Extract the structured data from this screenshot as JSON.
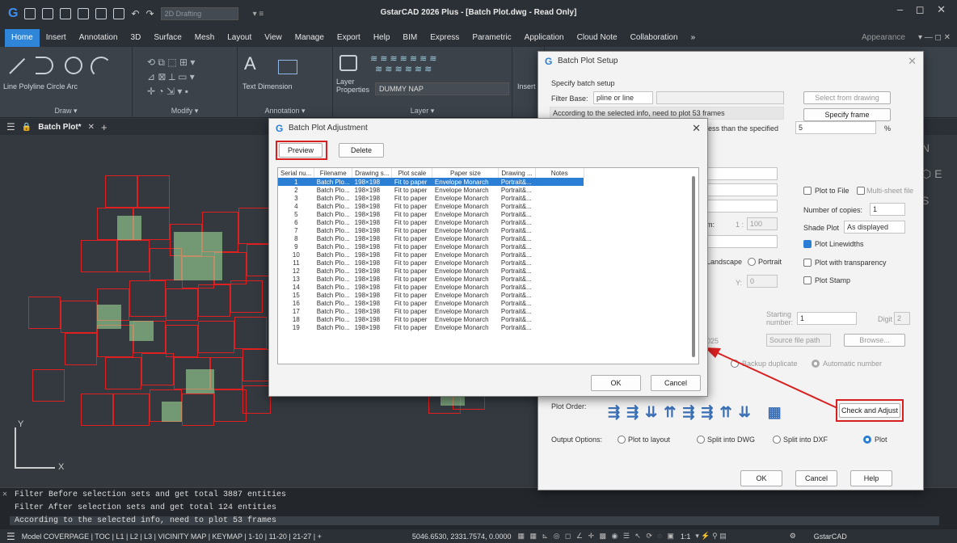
{
  "title": "GstarCAD 2026 Plus - [Batch Plot.dwg - Read Only]",
  "workspace": "2D Drafting",
  "qat_icons": [
    "new-icon",
    "open-icon",
    "save-icon",
    "saveas-icon",
    "publish-icon",
    "print-icon",
    "undo-icon",
    "redo-icon"
  ],
  "menu": [
    "Home",
    "Insert",
    "Annotation",
    "3D",
    "Surface",
    "Mesh",
    "Layout",
    "View",
    "Manage",
    "Export",
    "Help",
    "BIM",
    "Express",
    "Parametric",
    "Application",
    "Cloud Note",
    "Collaboration",
    "»"
  ],
  "appearance": "Appearance",
  "ribbon": {
    "draw": {
      "buttons": "Line  Polyline  Circle    Arc",
      "label": "Draw ▾"
    },
    "modify": {
      "label": "Modify ▾"
    },
    "annotation": {
      "buttons": "Text   Dimension",
      "label": "Annotation ▾"
    },
    "layer": {
      "buttons": "Layer\nProperties",
      "label": "Layer ▾",
      "current": "DUMMY NAP"
    },
    "insert": "Insert"
  },
  "doc_tab": "Batch Plot*",
  "command_lines": [
    "Filter Before selection sets and get total 3887 entities",
    "Filter After selection sets and get total 124 entities",
    "According to the selected info, need to plot 53 frames"
  ],
  "status": {
    "tabs": "Model  COVERPAGE | TOC | L1 | L2 | L3 | VICINITY MAP | KEYMAP | 1-10 | 11-20 | 21-27 |  +",
    "coords": "5046.6530, 2331.7574, 0.0000",
    "scale": "1:1",
    "app": "GstarCAD"
  },
  "setup": {
    "title": "Batch Plot Setup",
    "section": "Specify batch setup",
    "filter_base_label": "Filter Base:",
    "filter_base_value": "pline or line",
    "select_from_drawing": "Select from drawing",
    "info": "According to the selected info, need to plot 53 frames",
    "specify_frame": "Specify frame",
    "less_than": "less than the specified",
    "pct_value": "5",
    "pct": "%",
    "plot_to_file": "Plot to File",
    "multi_sheet": "Multi-sheet file",
    "copies_label": "Number of copies:",
    "copies": "1",
    "shade_label": "Shade Plot",
    "shade_value": "As displayed",
    "scale_m": "m:",
    "scale_1": "1 :",
    "scale_val": "100",
    "plot_linewidths": "Plot Linewidths",
    "landscape": "Landscape",
    "portrait": "Portrait",
    "transparency": "Plot with transparency",
    "y_label": "Y:",
    "y_val": "0",
    "stamp": "Plot Stamp",
    "starting_label": "Starting\nnumber:",
    "starting": "1",
    "digit_label": "Digit",
    "digit": "2",
    "num_025": "025",
    "source": "Source file path",
    "browse": "Browse...",
    "backup": "Backup duplicate",
    "auto_number": "Automatic number",
    "plot_order": "Plot Order:",
    "check_adjust": "Check and Adjust",
    "output_label": "Output Options:",
    "out_layout": "Plot to layout",
    "out_dwg": "Split into DWG",
    "out_dxf": "Split into DXF",
    "out_plot": "Plot",
    "ok": "OK",
    "cancel": "Cancel",
    "help": "Help"
  },
  "adjust": {
    "title": "Batch Plot Adjustment",
    "preview": "Preview",
    "delete": "Delete",
    "columns": [
      "Serial nu...",
      "Filename",
      "Drawing s...",
      "Plot scale",
      "Paper size",
      "Drawing ...",
      "Notes"
    ],
    "rows": [
      [
        "1",
        "Batch Plo...",
        "198×198",
        "Fit to paper",
        "Envelope Monarch",
        "Portrait&..."
      ],
      [
        "2",
        "Batch Plo...",
        "198×198",
        "Fit to paper",
        "Envelope Monarch",
        "Portrait&..."
      ],
      [
        "3",
        "Batch Plo...",
        "198×198",
        "Fit to paper",
        "Envelope Monarch",
        "Portrait&..."
      ],
      [
        "4",
        "Batch Plo...",
        "198×198",
        "Fit to paper",
        "Envelope Monarch",
        "Portrait&..."
      ],
      [
        "5",
        "Batch Plo...",
        "198×198",
        "Fit to paper",
        "Envelope Monarch",
        "Portrait&..."
      ],
      [
        "6",
        "Batch Plo...",
        "198×198",
        "Fit to paper",
        "Envelope Monarch",
        "Portrait&..."
      ],
      [
        "7",
        "Batch Plo...",
        "198×198",
        "Fit to paper",
        "Envelope Monarch",
        "Portrait&..."
      ],
      [
        "8",
        "Batch Plo...",
        "198×198",
        "Fit to paper",
        "Envelope Monarch",
        "Portrait&..."
      ],
      [
        "9",
        "Batch Plo...",
        "198×198",
        "Fit to paper",
        "Envelope Monarch",
        "Portrait&..."
      ],
      [
        "10",
        "Batch Plo...",
        "198×198",
        "Fit to paper",
        "Envelope Monarch",
        "Portrait&..."
      ],
      [
        "11",
        "Batch Plo...",
        "198×198",
        "Fit to paper",
        "Envelope Monarch",
        "Portrait&..."
      ],
      [
        "12",
        "Batch Plo...",
        "198×198",
        "Fit to paper",
        "Envelope Monarch",
        "Portrait&..."
      ],
      [
        "13",
        "Batch Plo...",
        "198×198",
        "Fit to paper",
        "Envelope Monarch",
        "Portrait&..."
      ],
      [
        "14",
        "Batch Plo...",
        "198×198",
        "Fit to paper",
        "Envelope Monarch",
        "Portrait&..."
      ],
      [
        "15",
        "Batch Plo...",
        "198×198",
        "Fit to paper",
        "Envelope Monarch",
        "Portrait&..."
      ],
      [
        "16",
        "Batch Plo...",
        "198×198",
        "Fit to paper",
        "Envelope Monarch",
        "Portrait&..."
      ],
      [
        "17",
        "Batch Plo...",
        "198×198",
        "Fit to paper",
        "Envelope Monarch",
        "Portrait&..."
      ],
      [
        "18",
        "Batch Plo...",
        "198×198",
        "Fit to paper",
        "Envelope Monarch",
        "Portrait&..."
      ],
      [
        "19",
        "Batch Plo...",
        "198×198",
        "Fit to paper",
        "Envelope Monarch",
        "Portrait&..."
      ]
    ],
    "ok": "OK",
    "cancel": "Cancel"
  },
  "colors": {
    "accent": "#2f86d8",
    "frame_red": "#e02020",
    "callout_red": "#d92020"
  }
}
